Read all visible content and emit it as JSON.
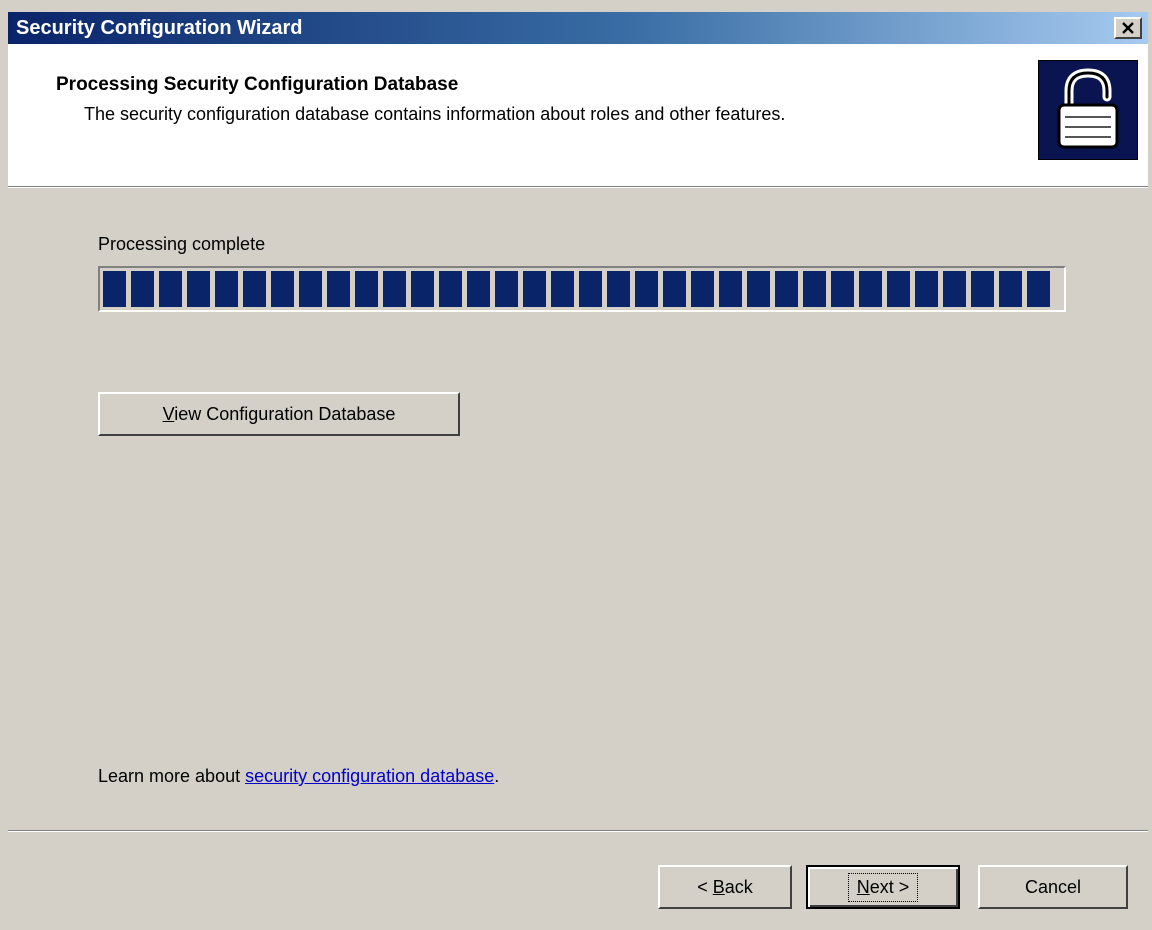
{
  "window": {
    "title": "Security Configuration Wizard"
  },
  "header": {
    "title": "Processing Security Configuration Database",
    "description": "The security configuration database contains information about roles and other features.",
    "icon": "padlock-icon"
  },
  "main": {
    "status_label": "Processing complete",
    "progress": {
      "value": 1.0,
      "segments": 34
    },
    "view_button": {
      "accel": "V",
      "rest": "iew Configuration Database"
    },
    "learn_more": {
      "prefix": "Learn more about ",
      "link_text": "security configuration database",
      "suffix": "."
    }
  },
  "footer": {
    "back": {
      "prefix": "< ",
      "accel": "B",
      "rest": "ack"
    },
    "next": {
      "accel": "N",
      "rest": "ext >"
    },
    "cancel": "Cancel"
  },
  "colors": {
    "titlebar_start": "#0a246a",
    "titlebar_end": "#a6caf0",
    "face": "#d4d0c8",
    "progress_fill": "#0a246a",
    "link": "#0000cc"
  }
}
